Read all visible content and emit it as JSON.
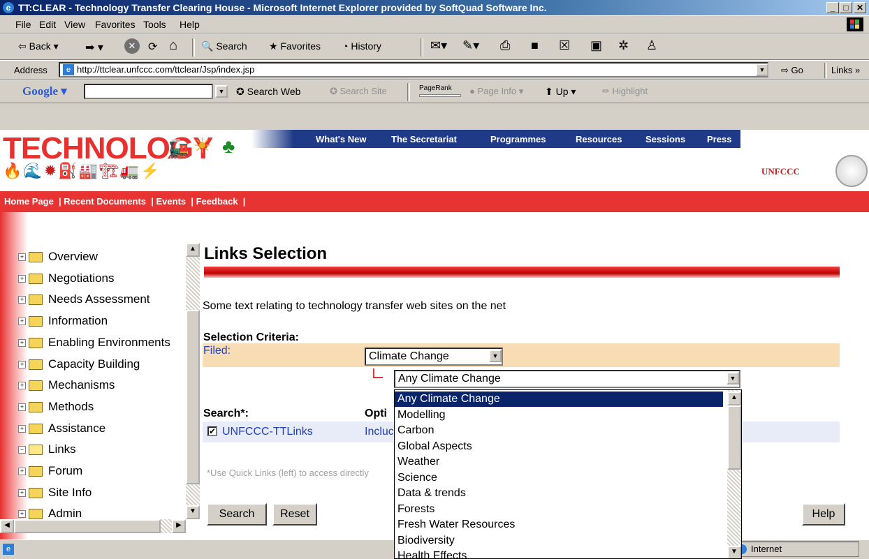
{
  "window": {
    "title": "TT:CLEAR - Technology Transfer Clearing House - Microsoft Internet Explorer provided by SoftQuad Software Inc."
  },
  "menu": [
    "File",
    "Edit",
    "View",
    "Favorites",
    "Tools",
    "Help"
  ],
  "toolbar": {
    "back": "Back",
    "search": "Search",
    "favorites": "Favorites",
    "history": "History"
  },
  "address": {
    "label": "Address",
    "url": "http://ttclear.unfccc.com/ttclear/Jsp/index.jsp",
    "go": "Go",
    "links": "Links"
  },
  "google": {
    "logo": "Google",
    "search_web": "Search Web",
    "search_site": "Search Site",
    "pagerank": "PageRank",
    "page_info": "Page Info",
    "up": "Up",
    "highlight": "Highlight"
  },
  "site": {
    "banner": "TECHNOLOGY",
    "logo": "UNFCCC",
    "topnav": [
      "What's New",
      "The Secretariat",
      "Programmes",
      "Resources",
      "Sessions",
      "Press"
    ],
    "subnav": "Home Page  | Recent Documents  | Events  | Feedback  |"
  },
  "sidebar": {
    "items": [
      "Overview",
      "Negotiations",
      "Needs Assessment",
      "Information",
      "Enabling Environments",
      "Capacity Building",
      "Mechanisms",
      "Methods",
      "Assistance",
      "Links",
      "Forum",
      "Site Info",
      "Admin"
    ]
  },
  "main": {
    "title": "Links Selection",
    "intro": "Some text relating to technology transfer web sites on the net",
    "criteria_label": "Selection Criteria:",
    "filed_label": "Filed:",
    "filed_value": "Climate Change",
    "sub_value": "Any Climate Change",
    "search_label": "Search*:",
    "options_label": "Opti",
    "checkbox_label": "UNFCCC-TTLinks",
    "include_text": "Incluc",
    "note": "*Use Quick Links (left) to access directly",
    "search_button": "Search",
    "reset_button": "Reset",
    "help_button": "Help"
  },
  "dropdown_options": [
    "Any Climate Change",
    "Modelling",
    "Carbon",
    "Global Aspects",
    "Weather",
    "Science",
    "Data & trends",
    "Forests",
    "Fresh Water Resources",
    "Biodiversity",
    "Health Effects"
  ],
  "status": {
    "zone": "Internet"
  }
}
